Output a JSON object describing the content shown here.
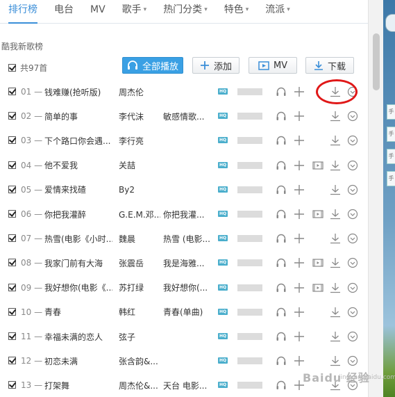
{
  "nav": {
    "items": [
      {
        "label": "排行榜",
        "active": true,
        "dropdown": false
      },
      {
        "label": "电台",
        "active": false,
        "dropdown": false
      },
      {
        "label": "MV",
        "active": false,
        "dropdown": false
      },
      {
        "label": "歌手",
        "active": false,
        "dropdown": true
      },
      {
        "label": "热门分类",
        "active": false,
        "dropdown": true
      },
      {
        "label": "特色",
        "active": false,
        "dropdown": true
      },
      {
        "label": "流派",
        "active": false,
        "dropdown": true
      }
    ],
    "accent_color": "#3a8ed8"
  },
  "chart_title": "酷我新歌榜",
  "song_count": "共97首",
  "toolbar": {
    "play_all": "全部播放",
    "add": "添加",
    "mv": "MV",
    "download": "下载",
    "primary_color": "#3aa0e4"
  },
  "hq_label": "HQ",
  "songs": [
    {
      "index": "01",
      "title": "钱难赚(抢听版)",
      "artist": "周杰伦",
      "album": "",
      "has_mv": false
    },
    {
      "index": "02",
      "title": "简单的事",
      "artist": "李代沫",
      "album": "敏感情歌...",
      "has_mv": false
    },
    {
      "index": "03",
      "title": "下个路口你会遇...",
      "artist": "李行亮",
      "album": "",
      "has_mv": false
    },
    {
      "index": "04",
      "title": "他不爱我",
      "artist": "关喆",
      "album": "",
      "has_mv": true
    },
    {
      "index": "05",
      "title": "爱情来找碴",
      "artist": "By2",
      "album": "",
      "has_mv": false
    },
    {
      "index": "06",
      "title": "你把我灌醉",
      "artist": "G.E.M.邓...",
      "album": "你把我灌...",
      "has_mv": true
    },
    {
      "index": "07",
      "title": "热雪(电影《小时...",
      "artist": "魏晨",
      "album": "热雪 (电影...",
      "has_mv": false
    },
    {
      "index": "08",
      "title": "我家门前有大海",
      "artist": "张震岳",
      "album": "我是海雅...",
      "has_mv": true
    },
    {
      "index": "09",
      "title": "我好想你(电影《...",
      "artist": "苏打绿",
      "album": "我好想你(...",
      "has_mv": true
    },
    {
      "index": "10",
      "title": "青春",
      "artist": "韩红",
      "album": "青春(单曲)",
      "has_mv": false
    },
    {
      "index": "11",
      "title": "幸福未满的恋人",
      "artist": "弦子",
      "album": "",
      "has_mv": false
    },
    {
      "index": "12",
      "title": "初恋未满",
      "artist": "张含韵&...",
      "album": "",
      "has_mv": false
    },
    {
      "index": "13",
      "title": "打架舞",
      "artist": "周杰伦&...",
      "album": "天台 电影...",
      "has_mv": false
    }
  ],
  "watermark": {
    "main": "Baidu 经验",
    "sub": "jingyan.baidu.com"
  },
  "side_tabs": [
    "手",
    "手",
    "手",
    "手"
  ]
}
